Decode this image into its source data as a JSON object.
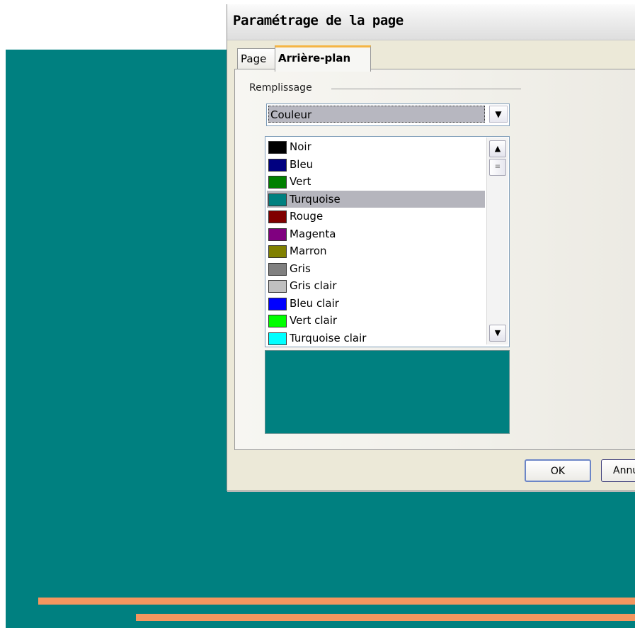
{
  "dialog": {
    "title": "Paramétrage de la page",
    "tabs": [
      {
        "label": "Page",
        "active": false
      },
      {
        "label": "Arrière-plan",
        "active": true
      }
    ],
    "fill_group_label": "Remplissage",
    "fill_type": {
      "value": "Couleur"
    },
    "colors": [
      {
        "label": "Noir",
        "color": "#000000"
      },
      {
        "label": "Bleu",
        "color": "#000080"
      },
      {
        "label": "Vert",
        "color": "#008000"
      },
      {
        "label": "Turquoise",
        "color": "#008080",
        "selected": true
      },
      {
        "label": "Rouge",
        "color": "#800000"
      },
      {
        "label": "Magenta",
        "color": "#800080"
      },
      {
        "label": "Marron",
        "color": "#808000"
      },
      {
        "label": "Gris",
        "color": "#808080"
      },
      {
        "label": "Gris clair",
        "color": "#c0c0c0"
      },
      {
        "label": "Bleu clair",
        "color": "#0000ff"
      },
      {
        "label": "Vert clair",
        "color": "#00ff00"
      },
      {
        "label": "Turquoise clair",
        "color": "#00ffff"
      }
    ],
    "preview_color": "#008080",
    "buttons": {
      "ok": "OK",
      "cancel": "Annu"
    }
  },
  "background": {
    "slide_color": "#008080",
    "stripe_color": "#f4965f"
  }
}
